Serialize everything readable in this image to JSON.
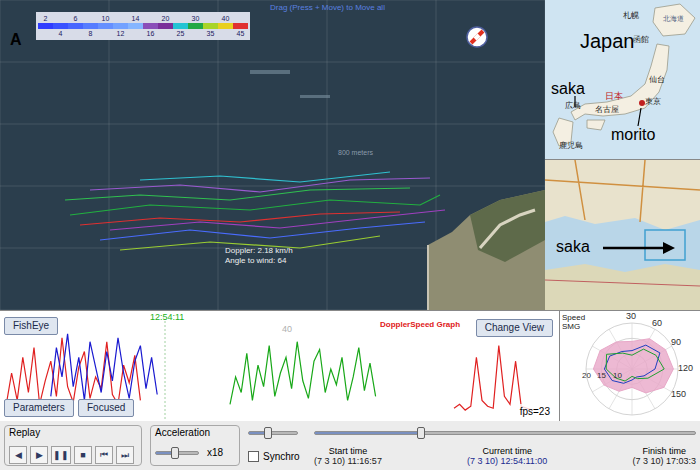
{
  "map": {
    "hint": "Drag (Press + Move) to Move all",
    "scale_label": "800 meters",
    "info": [
      "Doppler: 2.18 km/h",
      "Angle to wind: 64"
    ],
    "north": "A",
    "legend": [
      {
        "label": "2",
        "row": 0,
        "color": "#2f3cff"
      },
      {
        "label": "4",
        "row": 1,
        "color": "#3a52ff"
      },
      {
        "label": "6",
        "row": 0,
        "color": "#4766ff"
      },
      {
        "label": "8",
        "row": 1,
        "color": "#567cff"
      },
      {
        "label": "10",
        "row": 0,
        "color": "#6690ff"
      },
      {
        "label": "12",
        "row": 1,
        "color": "#74a2ff"
      },
      {
        "label": "14",
        "row": 0,
        "color": "#86b6ff"
      },
      {
        "label": "16",
        "row": 1,
        "color": "#8a4fb8"
      },
      {
        "label": "20",
        "row": 0,
        "color": "#7a2f9a"
      },
      {
        "label": "25",
        "row": 1,
        "color": "#24c4d4"
      },
      {
        "label": "30",
        "row": 0,
        "color": "#22a844"
      },
      {
        "label": "35",
        "row": 1,
        "color": "#a8d428"
      },
      {
        "label": "40",
        "row": 0,
        "color": "#e8d020"
      },
      {
        "label": "45",
        "row": 1,
        "color": "#e03030"
      }
    ],
    "tracks": [
      {
        "color": "#22b040",
        "points": [
          [
            70,
            215
          ],
          [
            150,
            205
          ],
          [
            250,
            210
          ],
          [
            330,
            200
          ],
          [
            420,
            205
          ],
          [
            440,
            195
          ]
        ]
      },
      {
        "color": "#9a5ad0",
        "points": [
          [
            90,
            190
          ],
          [
            180,
            185
          ],
          [
            260,
            192
          ],
          [
            350,
            180
          ],
          [
            430,
            178
          ]
        ]
      },
      {
        "color": "#e03030",
        "points": [
          [
            80,
            225
          ],
          [
            160,
            218
          ],
          [
            240,
            222
          ],
          [
            320,
            214
          ],
          [
            400,
            212
          ]
        ]
      },
      {
        "color": "#4a6cff",
        "points": [
          [
            100,
            240
          ],
          [
            190,
            230
          ],
          [
            270,
            238
          ],
          [
            360,
            228
          ],
          [
            425,
            222
          ]
        ]
      },
      {
        "color": "#30c050",
        "points": [
          [
            65,
            200
          ],
          [
            140,
            195
          ],
          [
            230,
            200
          ],
          [
            310,
            190
          ],
          [
            410,
            188
          ]
        ]
      },
      {
        "color": "#9acd32",
        "points": [
          [
            120,
            250
          ],
          [
            210,
            242
          ],
          [
            300,
            248
          ],
          [
            380,
            236
          ]
        ]
      },
      {
        "color": "#30c0d0",
        "points": [
          [
            140,
            180
          ],
          [
            220,
            176
          ],
          [
            300,
            182
          ],
          [
            390,
            172
          ]
        ]
      },
      {
        "color": "#a040c0",
        "points": [
          [
            110,
            230
          ],
          [
            200,
            222
          ],
          [
            280,
            228
          ],
          [
            370,
            218
          ],
          [
            445,
            210
          ]
        ]
      }
    ]
  },
  "inset_japan": {
    "labels": [
      "Japan",
      "saka",
      "morito",
      "札幌",
      "函館",
      "仙台",
      "日本",
      "東京",
      "広島",
      "名古屋",
      "鹿児島",
      "北海道"
    ]
  },
  "inset_local": {
    "label": "saka"
  },
  "graph": {
    "title": "DopplerSpeed Graph",
    "buttons": [
      "FishEye",
      "Change View",
      "Parameters",
      "Focused"
    ],
    "cursor_time": "12:54:11",
    "tick": "40",
    "fps": "fps=23",
    "series": [
      {
        "color": "#e02020",
        "start": 0,
        "values": [
          5,
          22,
          8,
          30,
          12,
          35,
          6,
          18,
          28,
          10,
          40,
          15,
          7,
          25,
          33,
          9,
          20,
          14,
          38,
          11,
          6,
          26,
          17,
          31,
          8
        ]
      },
      {
        "color": "#1a1ad0",
        "start": 8,
        "values": [
          10,
          35,
          20,
          42,
          15,
          30,
          8,
          38,
          25,
          12,
          33,
          18,
          40,
          22,
          9,
          28,
          36,
          14,
          30,
          11
        ]
      },
      {
        "color": "#18a818",
        "start": 40,
        "values": [
          6,
          20,
          12,
          32,
          8,
          26,
          15,
          36,
          10,
          22,
          30,
          14,
          38,
          18,
          9,
          28,
          34,
          12,
          24,
          16,
          30,
          8,
          20,
          35,
          13,
          27,
          10
        ]
      },
      {
        "color": "#e02020",
        "start": 80,
        "values": [
          4,
          6,
          3,
          5,
          30,
          8,
          5,
          4,
          36,
          10,
          6,
          28,
          5,
          4,
          3
        ]
      }
    ]
  },
  "polar": {
    "legend": [
      "Speed",
      "SMG"
    ],
    "angle_ticks": [
      "30",
      "60",
      "90",
      "120",
      "150"
    ],
    "radial_ticks": [
      "10",
      "15",
      "20"
    ],
    "series": [
      {
        "color": "#e8a8c8",
        "values": [
          30,
          38,
          42,
          45,
          40,
          30,
          20,
          28,
          35,
          42,
          40,
          34
        ]
      },
      {
        "color": "#2040c0",
        "values": [
          20,
          30,
          35,
          25,
          15,
          10,
          12,
          18,
          25,
          30,
          28,
          22
        ]
      },
      {
        "color": "#20a030",
        "values": [
          15,
          25,
          30,
          35,
          20,
          12,
          8,
          15,
          20,
          28,
          32,
          20
        ]
      }
    ]
  },
  "controls": {
    "replay": {
      "label": "Replay",
      "buttons": [
        "◀",
        "▶",
        "❚❚",
        "■",
        "⏮",
        "⏭"
      ]
    },
    "acceleration": {
      "label": "Acceleration",
      "level": 0.45,
      "reading": "x18"
    },
    "small_slider": {
      "level": 0.4
    },
    "timeline": {
      "level": 0.28
    },
    "synchro": {
      "label": "Synchro",
      "checked": false
    },
    "times": [
      {
        "label": "Start time",
        "value": "(7 3 10) 11:16:57"
      },
      {
        "label": "Current time",
        "value": "(7 3 10) 12:54:11:00"
      },
      {
        "label": "Finish time",
        "value": "(7 3 10) 17:03:3"
      }
    ]
  }
}
